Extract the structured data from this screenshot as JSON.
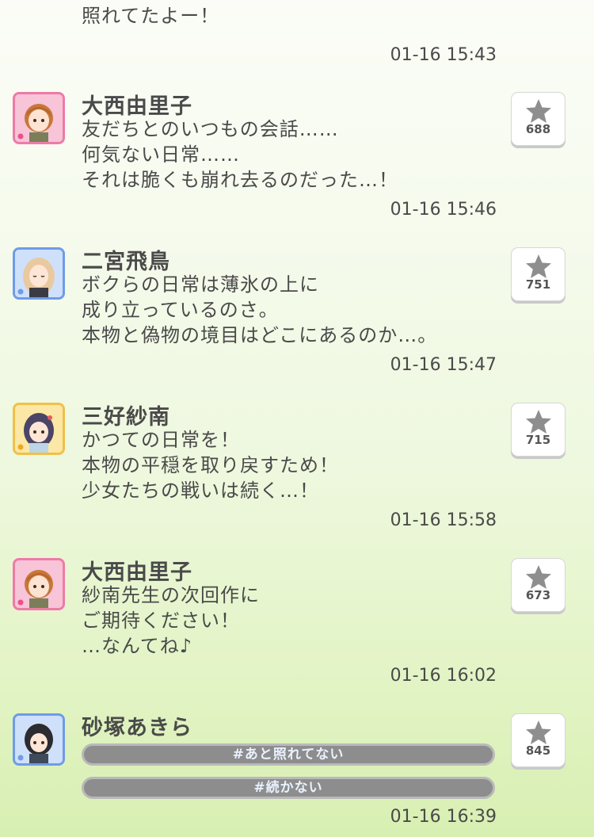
{
  "messages": [
    {
      "name": "",
      "lines": "ありがとナス…だって！\n照れてたよー！",
      "time": "01-16 15:43"
    },
    {
      "name": "大西由里子",
      "avatar": "pink",
      "lines": "友だちとのいつもの会話……\n何気ない日常……\nそれは脆くも崩れ去るのだった…！",
      "time": "01-16 15:46",
      "stars": "688"
    },
    {
      "name": "二宮飛鳥",
      "avatar": "blue",
      "lines": "ボクらの日常は薄氷の上に\n成り立っているのさ。\n本物と偽物の境目はどこにあるのか…。",
      "time": "01-16 15:47",
      "stars": "751"
    },
    {
      "name": "三好紗南",
      "avatar": "yellow",
      "lines": "かつての日常を！\n本物の平穏を取り戻すため！\n少女たちの戦いは続く…！",
      "time": "01-16 15:58",
      "stars": "715"
    },
    {
      "name": "大西由里子",
      "avatar": "pink",
      "lines": "紗南先生の次回作に\nご期待ください！\n…なんてね♪",
      "time": "01-16 16:02",
      "stars": "673"
    },
    {
      "name": "砂塚あきら",
      "avatar": "blue",
      "tags": [
        "#あと照れてない",
        "#続かない"
      ],
      "time": "01-16 16:39",
      "stars": "845"
    }
  ],
  "colors": {
    "pink_frame": "#ee7aa8",
    "blue_frame": "#6f9be8",
    "yellow_frame": "#f0c04a",
    "star": "#8e8e8e",
    "tag_bg": "#8d8d8d"
  }
}
